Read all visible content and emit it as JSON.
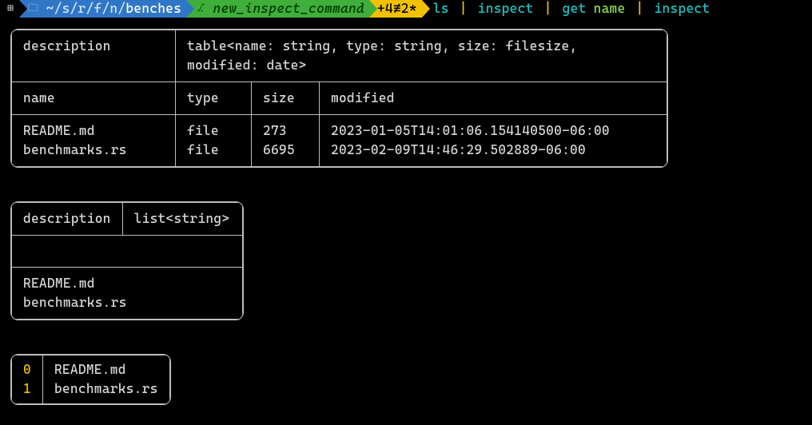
{
  "prompt": {
    "os_icon": "⊞",
    "folder_icon": "🗀",
    "path_prefix": "~/s/r/f/n/",
    "path_leaf": "benches",
    "branch_icon": "⎇",
    "branch": "new_inspect_command",
    "status": "+4≢2*"
  },
  "command": {
    "parts": [
      "ls",
      "inspect",
      "get",
      "name",
      "inspect"
    ]
  },
  "table1": {
    "desc_label": "description",
    "desc_value": "table<name: string, type: string, size: filesize, modified: date>",
    "headers": [
      "name",
      "type",
      "size",
      "modified"
    ],
    "rows": [
      {
        "name": "README.md",
        "type": "file",
        "size": "273",
        "modified": "2023-01-05T14:01:06.154140500-06:00"
      },
      {
        "name": "benchmarks.rs",
        "type": "file",
        "size": "6695",
        "modified": "2023-02-09T14:46:29.502889-06:00"
      }
    ]
  },
  "table2": {
    "desc_label": "description",
    "desc_value": "list<string>",
    "items": [
      "README.md",
      "benchmarks.rs"
    ]
  },
  "table3": {
    "rows": [
      {
        "idx": "0",
        "val": "README.md"
      },
      {
        "idx": "1",
        "val": "benchmarks.rs"
      }
    ]
  }
}
